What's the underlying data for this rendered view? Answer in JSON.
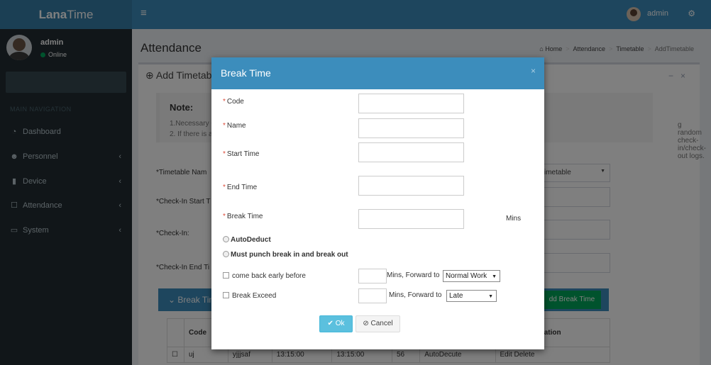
{
  "header": {
    "logo_bold": "Lana",
    "logo_rest": "Time",
    "menu_icon": "hamburger-icon",
    "user_name": "admin",
    "settings_icon": "cogs-icon"
  },
  "sidebar": {
    "user_name": "admin",
    "status": "Online",
    "nav_header": "MAIN NAVIGATION",
    "items": [
      {
        "label": "Dashboard",
        "icon": "dashboard-icon"
      },
      {
        "label": "Personnel",
        "icon": "users-icon"
      },
      {
        "label": "Device",
        "icon": "device-icon"
      },
      {
        "label": "Attendance",
        "icon": "calendar-icon"
      },
      {
        "label": "System",
        "icon": "laptop-icon"
      }
    ]
  },
  "page": {
    "title": "Attendance",
    "breadcrumb": [
      "Home",
      "Attendance",
      "Timetable",
      "AddTimetable"
    ]
  },
  "background_form": {
    "box_title": "Add Timetable",
    "note_title": "Note:",
    "note_line1": "1.Necessary C",
    "note_line2": "2. If there is a",
    "note_tail": "g random check-in/check-out logs.",
    "label_timetable_name": "*Timetable Nam",
    "label_checkin_start": "*Check-In Start T",
    "label_checkin": "*Check-In:",
    "label_checkin_end": "*Check-In End Ti",
    "select_value": "imetable",
    "break_table_title": "Break Tim",
    "add_break_label": "dd Break Time",
    "table_headers": [
      "Code",
      "",
      "",
      "",
      "",
      "Related Operation"
    ],
    "table_row": [
      "uj",
      "yjjjsaf",
      "13:15:00",
      "13:15:00",
      "56",
      "AutoDecute",
      "Edit Delete"
    ]
  },
  "modal": {
    "title": "Break Time",
    "fields": {
      "code_label": "Code",
      "name_label": "Name",
      "start_label": "Start Time",
      "end_label": "End Time",
      "break_label": "Break Time",
      "break_unit": "Mins"
    },
    "radio_auto": "AutoDeduct",
    "radio_punch": "Must punch break in and break out",
    "check_early": "come back early before",
    "check_exceed": "Break Exceed",
    "forward_early": "Mins, Forward to",
    "forward_exceed": "Mins, Forward to",
    "select_early": "Normal Work",
    "select_exceed": "Late",
    "ok_label": "Ok",
    "cancel_label": "Cancel"
  }
}
